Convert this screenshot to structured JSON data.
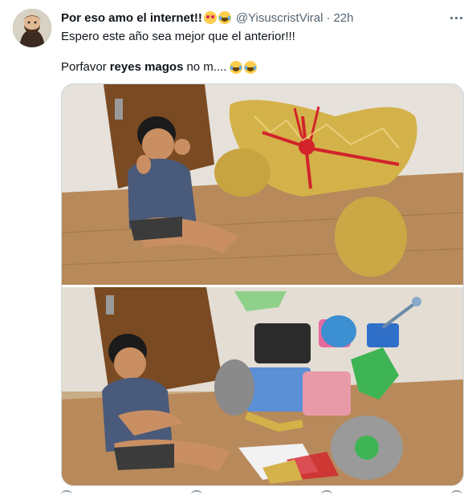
{
  "tweet": {
    "display_name": "Por eso amo el internet!!",
    "handle": "@YisuscristViral",
    "separator": "·",
    "time": "22h",
    "line1": "Espero este año sea mejor que el anterior!!!",
    "line2_start": "Porfavor",
    "line2_bold": "reyes magos",
    "line2_end": "no m....",
    "emojis_after_name": [
      "heart-eyes-emoji",
      "joy-emoji"
    ],
    "emojis_after_text": [
      "joy-emoji",
      "joy-emoji"
    ]
  },
  "icons": {
    "more": "more-horizontal-icon"
  },
  "colors": {
    "text_primary": "#0f1419",
    "text_secondary": "#536471",
    "border": "#cfd9de",
    "gift_gold": "#d4b24a",
    "ribbon_red": "#d2232a"
  },
  "media": {
    "photo_count": 2
  }
}
